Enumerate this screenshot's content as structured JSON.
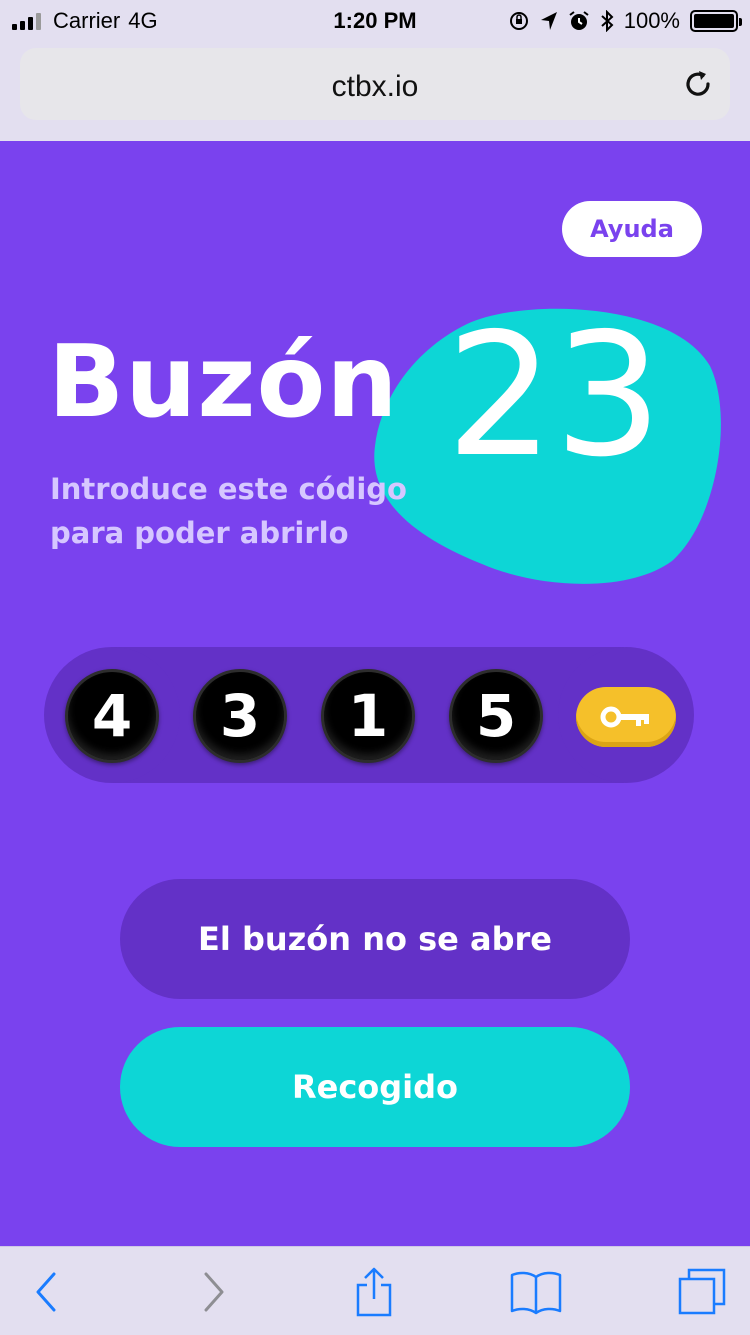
{
  "status_bar": {
    "carrier": "Carrier",
    "network": "4G",
    "time": "1:20 PM",
    "battery": "100%"
  },
  "browser": {
    "url": "ctbx.io"
  },
  "page": {
    "help_label": "Ayuda",
    "title": "Buzón",
    "mailbox_number": "23",
    "subtitle_line1": "Introduce este código",
    "subtitle_line2": "para poder abrirlo",
    "code_digits": [
      "4",
      "3",
      "1",
      "5"
    ],
    "secondary_button": "El buzón no se abre",
    "primary_button": "Recogido"
  },
  "colors": {
    "background": "#7a42ee",
    "accent_teal": "#0dd6d6",
    "dark_purple": "#6331c7",
    "key_yellow": "#f5c02a"
  },
  "icons": {
    "reload": "reload-icon",
    "key": "key-icon",
    "back": "back-icon",
    "forward": "forward-icon",
    "share": "share-icon",
    "bookmarks": "bookmarks-icon",
    "tabs": "tabs-icon"
  }
}
